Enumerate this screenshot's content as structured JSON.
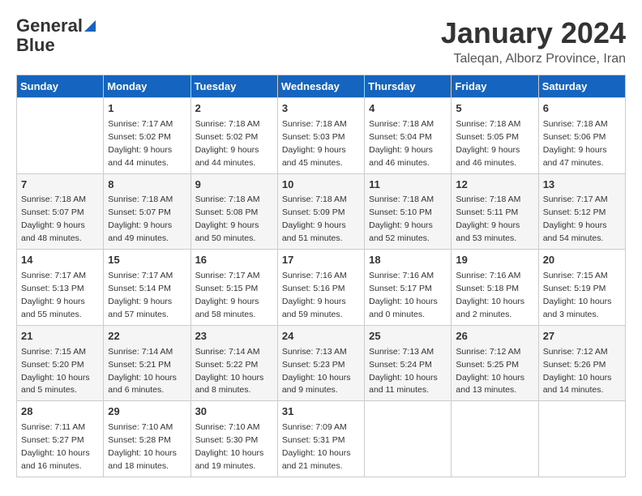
{
  "logo": {
    "line1": "General",
    "line2": "Blue"
  },
  "title": "January 2024",
  "location": "Taleqan, Alborz Province, Iran",
  "days_of_week": [
    "Sunday",
    "Monday",
    "Tuesday",
    "Wednesday",
    "Thursday",
    "Friday",
    "Saturday"
  ],
  "weeks": [
    [
      {
        "day": "",
        "sunrise": "",
        "sunset": "",
        "daylight": ""
      },
      {
        "day": "1",
        "sunrise": "Sunrise: 7:17 AM",
        "sunset": "Sunset: 5:02 PM",
        "daylight": "Daylight: 9 hours and 44 minutes."
      },
      {
        "day": "2",
        "sunrise": "Sunrise: 7:18 AM",
        "sunset": "Sunset: 5:02 PM",
        "daylight": "Daylight: 9 hours and 44 minutes."
      },
      {
        "day": "3",
        "sunrise": "Sunrise: 7:18 AM",
        "sunset": "Sunset: 5:03 PM",
        "daylight": "Daylight: 9 hours and 45 minutes."
      },
      {
        "day": "4",
        "sunrise": "Sunrise: 7:18 AM",
        "sunset": "Sunset: 5:04 PM",
        "daylight": "Daylight: 9 hours and 46 minutes."
      },
      {
        "day": "5",
        "sunrise": "Sunrise: 7:18 AM",
        "sunset": "Sunset: 5:05 PM",
        "daylight": "Daylight: 9 hours and 46 minutes."
      },
      {
        "day": "6",
        "sunrise": "Sunrise: 7:18 AM",
        "sunset": "Sunset: 5:06 PM",
        "daylight": "Daylight: 9 hours and 47 minutes."
      }
    ],
    [
      {
        "day": "7",
        "sunrise": "Sunrise: 7:18 AM",
        "sunset": "Sunset: 5:07 PM",
        "daylight": "Daylight: 9 hours and 48 minutes."
      },
      {
        "day": "8",
        "sunrise": "Sunrise: 7:18 AM",
        "sunset": "Sunset: 5:07 PM",
        "daylight": "Daylight: 9 hours and 49 minutes."
      },
      {
        "day": "9",
        "sunrise": "Sunrise: 7:18 AM",
        "sunset": "Sunset: 5:08 PM",
        "daylight": "Daylight: 9 hours and 50 minutes."
      },
      {
        "day": "10",
        "sunrise": "Sunrise: 7:18 AM",
        "sunset": "Sunset: 5:09 PM",
        "daylight": "Daylight: 9 hours and 51 minutes."
      },
      {
        "day": "11",
        "sunrise": "Sunrise: 7:18 AM",
        "sunset": "Sunset: 5:10 PM",
        "daylight": "Daylight: 9 hours and 52 minutes."
      },
      {
        "day": "12",
        "sunrise": "Sunrise: 7:18 AM",
        "sunset": "Sunset: 5:11 PM",
        "daylight": "Daylight: 9 hours and 53 minutes."
      },
      {
        "day": "13",
        "sunrise": "Sunrise: 7:17 AM",
        "sunset": "Sunset: 5:12 PM",
        "daylight": "Daylight: 9 hours and 54 minutes."
      }
    ],
    [
      {
        "day": "14",
        "sunrise": "Sunrise: 7:17 AM",
        "sunset": "Sunset: 5:13 PM",
        "daylight": "Daylight: 9 hours and 55 minutes."
      },
      {
        "day": "15",
        "sunrise": "Sunrise: 7:17 AM",
        "sunset": "Sunset: 5:14 PM",
        "daylight": "Daylight: 9 hours and 57 minutes."
      },
      {
        "day": "16",
        "sunrise": "Sunrise: 7:17 AM",
        "sunset": "Sunset: 5:15 PM",
        "daylight": "Daylight: 9 hours and 58 minutes."
      },
      {
        "day": "17",
        "sunrise": "Sunrise: 7:16 AM",
        "sunset": "Sunset: 5:16 PM",
        "daylight": "Daylight: 9 hours and 59 minutes."
      },
      {
        "day": "18",
        "sunrise": "Sunrise: 7:16 AM",
        "sunset": "Sunset: 5:17 PM",
        "daylight": "Daylight: 10 hours and 0 minutes."
      },
      {
        "day": "19",
        "sunrise": "Sunrise: 7:16 AM",
        "sunset": "Sunset: 5:18 PM",
        "daylight": "Daylight: 10 hours and 2 minutes."
      },
      {
        "day": "20",
        "sunrise": "Sunrise: 7:15 AM",
        "sunset": "Sunset: 5:19 PM",
        "daylight": "Daylight: 10 hours and 3 minutes."
      }
    ],
    [
      {
        "day": "21",
        "sunrise": "Sunrise: 7:15 AM",
        "sunset": "Sunset: 5:20 PM",
        "daylight": "Daylight: 10 hours and 5 minutes."
      },
      {
        "day": "22",
        "sunrise": "Sunrise: 7:14 AM",
        "sunset": "Sunset: 5:21 PM",
        "daylight": "Daylight: 10 hours and 6 minutes."
      },
      {
        "day": "23",
        "sunrise": "Sunrise: 7:14 AM",
        "sunset": "Sunset: 5:22 PM",
        "daylight": "Daylight: 10 hours and 8 minutes."
      },
      {
        "day": "24",
        "sunrise": "Sunrise: 7:13 AM",
        "sunset": "Sunset: 5:23 PM",
        "daylight": "Daylight: 10 hours and 9 minutes."
      },
      {
        "day": "25",
        "sunrise": "Sunrise: 7:13 AM",
        "sunset": "Sunset: 5:24 PM",
        "daylight": "Daylight: 10 hours and 11 minutes."
      },
      {
        "day": "26",
        "sunrise": "Sunrise: 7:12 AM",
        "sunset": "Sunset: 5:25 PM",
        "daylight": "Daylight: 10 hours and 13 minutes."
      },
      {
        "day": "27",
        "sunrise": "Sunrise: 7:12 AM",
        "sunset": "Sunset: 5:26 PM",
        "daylight": "Daylight: 10 hours and 14 minutes."
      }
    ],
    [
      {
        "day": "28",
        "sunrise": "Sunrise: 7:11 AM",
        "sunset": "Sunset: 5:27 PM",
        "daylight": "Daylight: 10 hours and 16 minutes."
      },
      {
        "day": "29",
        "sunrise": "Sunrise: 7:10 AM",
        "sunset": "Sunset: 5:28 PM",
        "daylight": "Daylight: 10 hours and 18 minutes."
      },
      {
        "day": "30",
        "sunrise": "Sunrise: 7:10 AM",
        "sunset": "Sunset: 5:30 PM",
        "daylight": "Daylight: 10 hours and 19 minutes."
      },
      {
        "day": "31",
        "sunrise": "Sunrise: 7:09 AM",
        "sunset": "Sunset: 5:31 PM",
        "daylight": "Daylight: 10 hours and 21 minutes."
      },
      {
        "day": "",
        "sunrise": "",
        "sunset": "",
        "daylight": ""
      },
      {
        "day": "",
        "sunrise": "",
        "sunset": "",
        "daylight": ""
      },
      {
        "day": "",
        "sunrise": "",
        "sunset": "",
        "daylight": ""
      }
    ]
  ]
}
